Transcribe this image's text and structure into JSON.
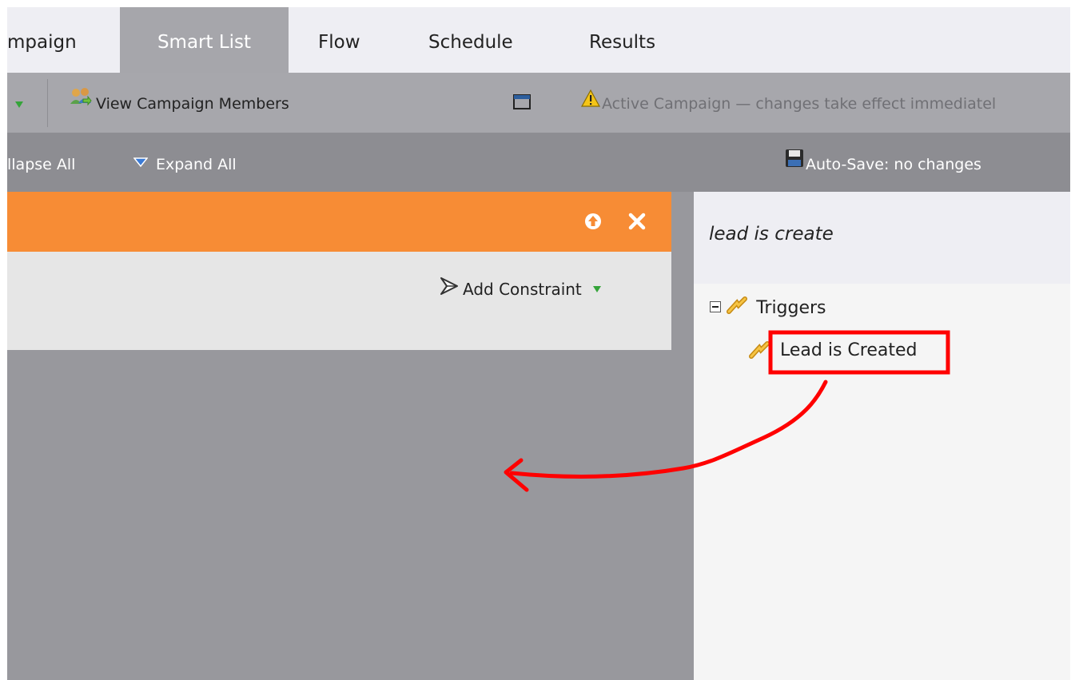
{
  "tabs": {
    "campaign": "mpaign",
    "smart_list": "Smart List",
    "flow": "Flow",
    "schedule": "Schedule",
    "results": "Results"
  },
  "toolbar": {
    "view_members": "View Campaign Members",
    "active_notice": "Active Campaign — changes take effect immediatel"
  },
  "subtoolbar": {
    "collapse_all": "llapse All",
    "expand_all": "Expand All",
    "autosave": "Auto-Save: no changes"
  },
  "filter": {
    "add_constraint": "Add Constraint"
  },
  "palette": {
    "search": "lead is create",
    "triggers_label": "Triggers",
    "trigger_item": "Lead is Created"
  },
  "colors": {
    "header_orange": "#f78c35",
    "annotation_red": "#ff0000",
    "active_tab": "#a6a6ab"
  }
}
